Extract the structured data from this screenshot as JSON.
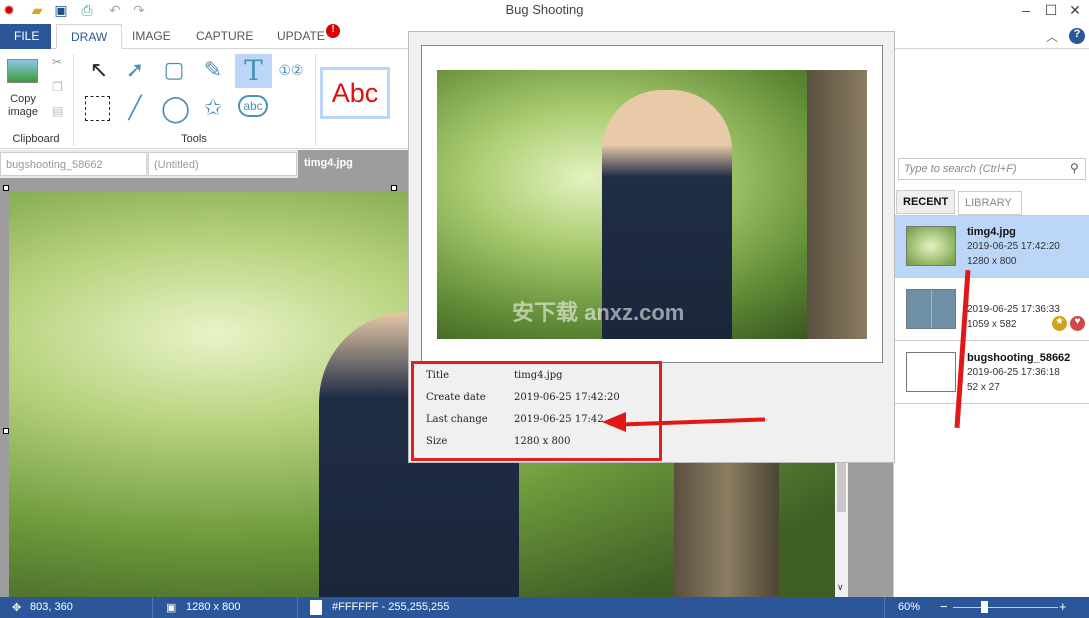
{
  "window": {
    "title": "Bug Shooting"
  },
  "quick_access": [
    {
      "icon": "bug-icon"
    },
    {
      "icon": "open-folder-icon"
    },
    {
      "icon": "save-icon"
    },
    {
      "icon": "print-icon"
    },
    {
      "icon": "undo-icon"
    },
    {
      "icon": "redo-icon"
    }
  ],
  "ribbon_tabs": [
    {
      "label": "FILE"
    },
    {
      "label": "DRAW"
    },
    {
      "label": "IMAGE"
    },
    {
      "label": "CAPTURE"
    },
    {
      "label": "UPDATE"
    }
  ],
  "ribbon": {
    "clipboard": {
      "copy_label": "Copy image",
      "group_label": "Clipboard"
    },
    "tools": {
      "group_label": "Tools"
    },
    "style_preview": "Abc"
  },
  "doc_tabs": [
    {
      "label": "bugshooting_58662"
    },
    {
      "label": "(Untitled)"
    },
    {
      "label": "timg4.jpg",
      "active": true
    }
  ],
  "search": {
    "placeholder": "Type to search (Ctrl+F)"
  },
  "panel_tabs": [
    {
      "label": "RECENT",
      "active": true
    },
    {
      "label": "LIBRARY"
    }
  ],
  "recent_items": [
    {
      "name": "timg4.jpg",
      "date": "2019-06-25 17:42:20",
      "size": "1280 x 800",
      "selected": true
    },
    {
      "name": "",
      "date": "2019-06-25 17:36:33",
      "size": "1059 x 582",
      "badges": [
        "star",
        "heart"
      ]
    },
    {
      "name": "bugshooting_58662",
      "date": "2019-06-25 17:36:18",
      "size": "52 x 27"
    }
  ],
  "popup": {
    "rows": [
      {
        "label": "Title",
        "value": "timg4.jpg"
      },
      {
        "label": "Create date",
        "value": "2019-06-25 17:42:20"
      },
      {
        "label": "Last change",
        "value": "2019-06-25 17:42"
      },
      {
        "label": "Size",
        "value": "1280 x 800"
      }
    ]
  },
  "watermark": "安下载 anxz.com",
  "status": {
    "cursor": "803, 360",
    "dimensions": "1280 x 800",
    "color": "#FFFFFF - 255,255,255",
    "zoom": "60%",
    "zoom_level": 60
  },
  "colors": {
    "accent": "#2b579a",
    "selected": "#bcd6f7",
    "highlight": "#e02020"
  }
}
